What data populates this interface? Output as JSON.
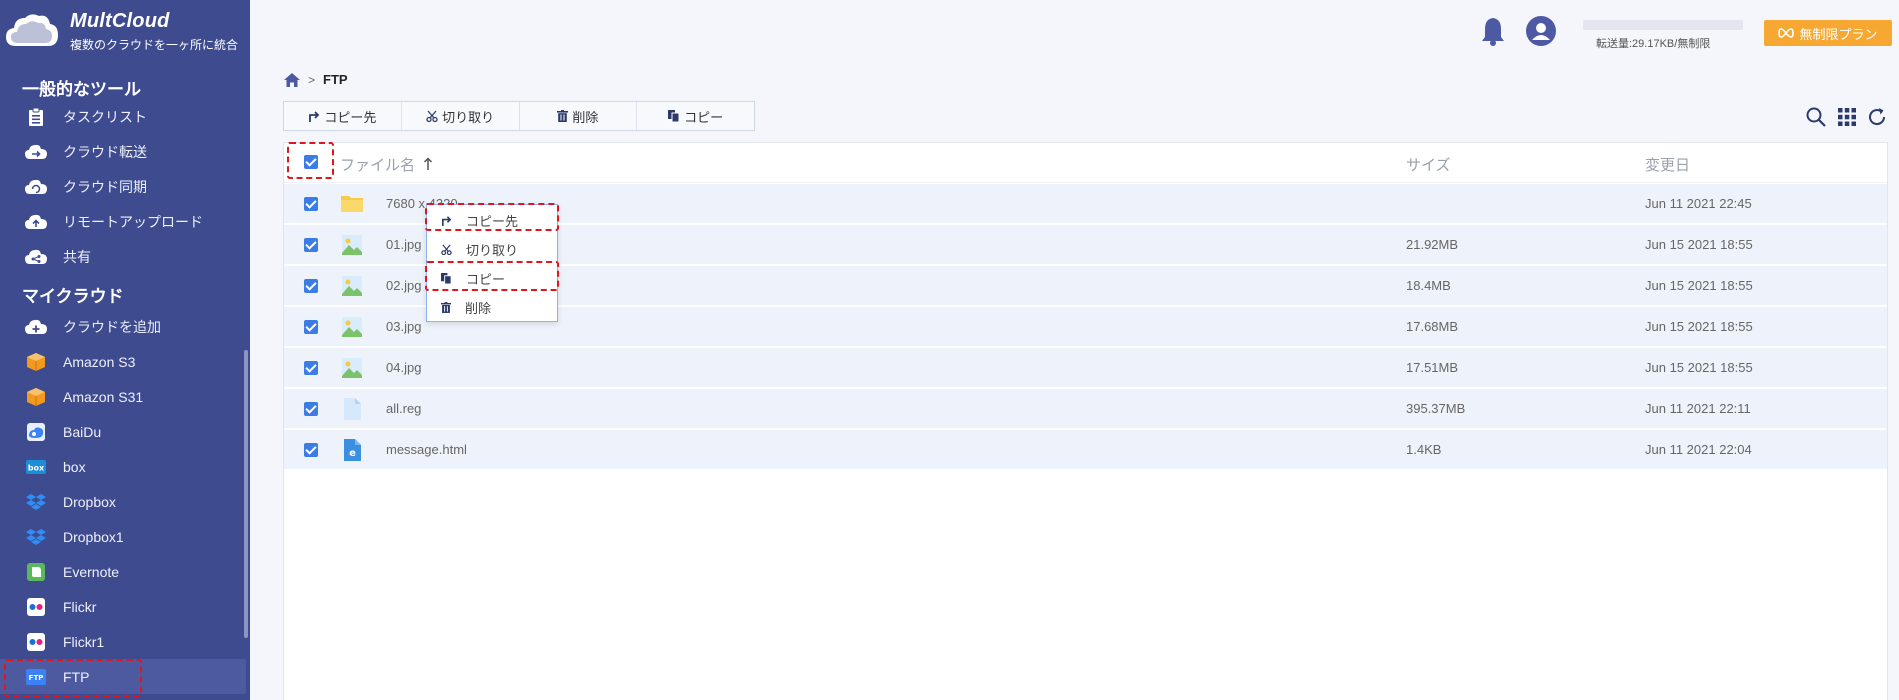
{
  "brand": {
    "name": "MultCloud",
    "tagline": "複数のクラウドを一ヶ所に統合"
  },
  "sidebar": {
    "common_title": "一般的なツール",
    "common": [
      {
        "label": "タスクリスト",
        "icon": "clipboard-icon"
      },
      {
        "label": "クラウド転送",
        "icon": "cloud-transfer-icon"
      },
      {
        "label": "クラウド同期",
        "icon": "cloud-sync-icon"
      },
      {
        "label": "リモートアップロード",
        "icon": "cloud-upload-icon"
      },
      {
        "label": "共有",
        "icon": "cloud-share-icon"
      }
    ],
    "my_title": "マイクラウド",
    "clouds": [
      {
        "label": "クラウドを追加",
        "icon": "cloud-add-icon"
      },
      {
        "label": "Amazon S3",
        "icon": "amazon-s3-icon"
      },
      {
        "label": "Amazon S31",
        "icon": "amazon-s3-icon"
      },
      {
        "label": "BaiDu",
        "icon": "baidu-icon"
      },
      {
        "label": "box",
        "icon": "box-icon"
      },
      {
        "label": "Dropbox",
        "icon": "dropbox-icon"
      },
      {
        "label": "Dropbox1",
        "icon": "dropbox-icon"
      },
      {
        "label": "Evernote",
        "icon": "evernote-icon"
      },
      {
        "label": "Flickr",
        "icon": "flickr-icon"
      },
      {
        "label": "Flickr1",
        "icon": "flickr-icon"
      },
      {
        "label": "FTP",
        "icon": "ftp-icon",
        "active": true
      }
    ]
  },
  "header": {
    "quota_text": "転送量:29.17KB/無制限",
    "plan_button": "無制限プラン",
    "quota_used_fraction": 0.0
  },
  "breadcrumb": {
    "current": "FTP"
  },
  "toolbar": {
    "copy_to": "コピー先",
    "cut": "切り取り",
    "delete": "削除",
    "copy": "コピー"
  },
  "table": {
    "columns": {
      "name": "ファイル名",
      "size": "サイズ",
      "modified": "変更日"
    },
    "rows": [
      {
        "name": "7680 x 4320",
        "size": "",
        "date": "Jun 11 2021 22:45",
        "type": "folder"
      },
      {
        "name": "01.jpg",
        "size": "21.92MB",
        "date": "Jun 15 2021 18:55",
        "type": "image"
      },
      {
        "name": "02.jpg",
        "size": "18.4MB",
        "date": "Jun 15 2021 18:55",
        "type": "image"
      },
      {
        "name": "03.jpg",
        "size": "17.68MB",
        "date": "Jun 15 2021 18:55",
        "type": "image"
      },
      {
        "name": "04.jpg",
        "size": "17.51MB",
        "date": "Jun 15 2021 18:55",
        "type": "image"
      },
      {
        "name": "all.reg",
        "size": "395.37MB",
        "date": "Jun 11 2021 22:11",
        "type": "file"
      },
      {
        "name": "message.html",
        "size": "1.4KB",
        "date": "Jun 11 2021 22:04",
        "type": "html"
      }
    ]
  },
  "context_menu": {
    "copy_to": "コピー先",
    "cut": "切り取り",
    "copy": "コピー",
    "delete": "削除"
  },
  "colors": {
    "sidebar": "#3f4b8f",
    "accent": "#3b7de5",
    "plan": "#f7a832",
    "highlight": "#e0151d"
  }
}
